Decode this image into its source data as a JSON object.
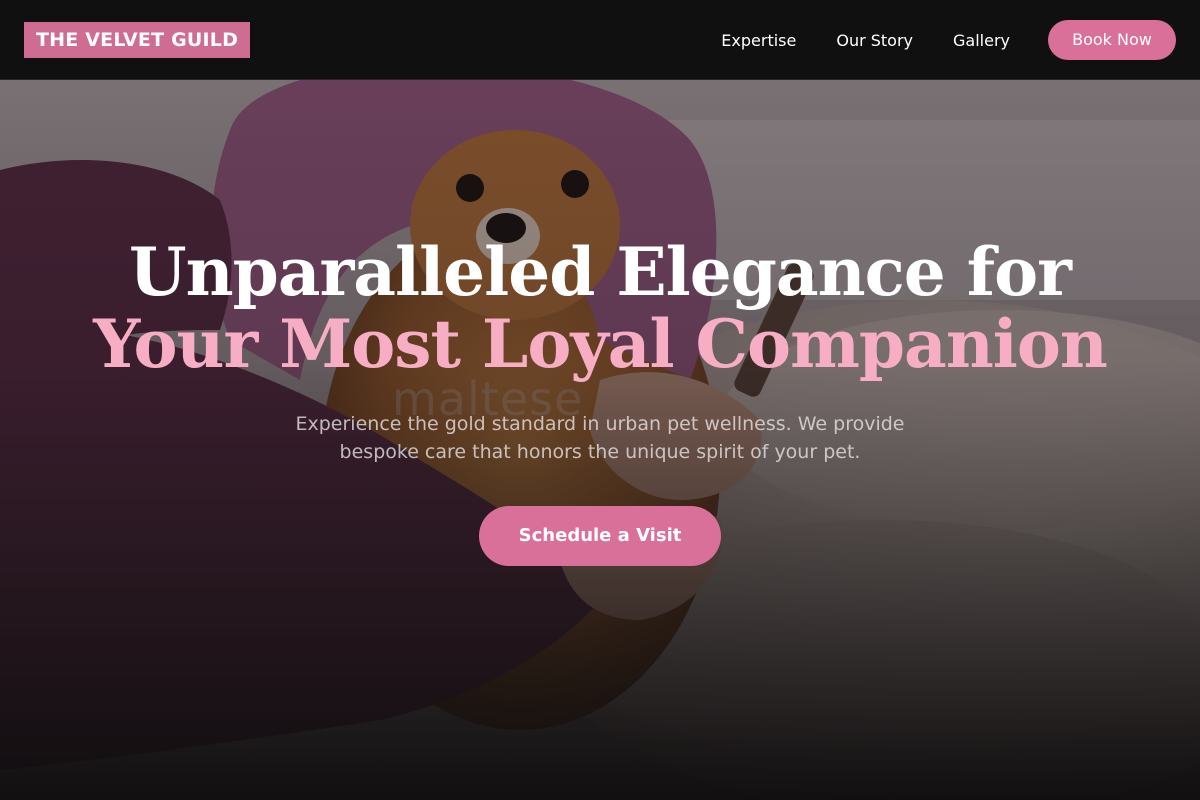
{
  "brand": {
    "name": "THE VELVET GUILD"
  },
  "nav": {
    "links": [
      {
        "label": "Expertise"
      },
      {
        "label": "Our Story"
      },
      {
        "label": "Gallery"
      }
    ],
    "cta_label": "Book Now"
  },
  "hero": {
    "headline_line1": "Unparalleled Elegance for",
    "headline_line2": "Your Most Loyal Companion",
    "subtext": "Experience the gold standard in urban pet wellness. We provide bespoke care that honors the unique spirit of your pet.",
    "cta_label": "Schedule a Visit",
    "photo_watermark": "maltese",
    "image_description_icon": "dog-grooming-photo"
  },
  "colors": {
    "accent": "#d9709a",
    "logo_bg": "#cf6c92",
    "headline_highlight": "#f7aec4",
    "navbar_bg": "#111011"
  }
}
